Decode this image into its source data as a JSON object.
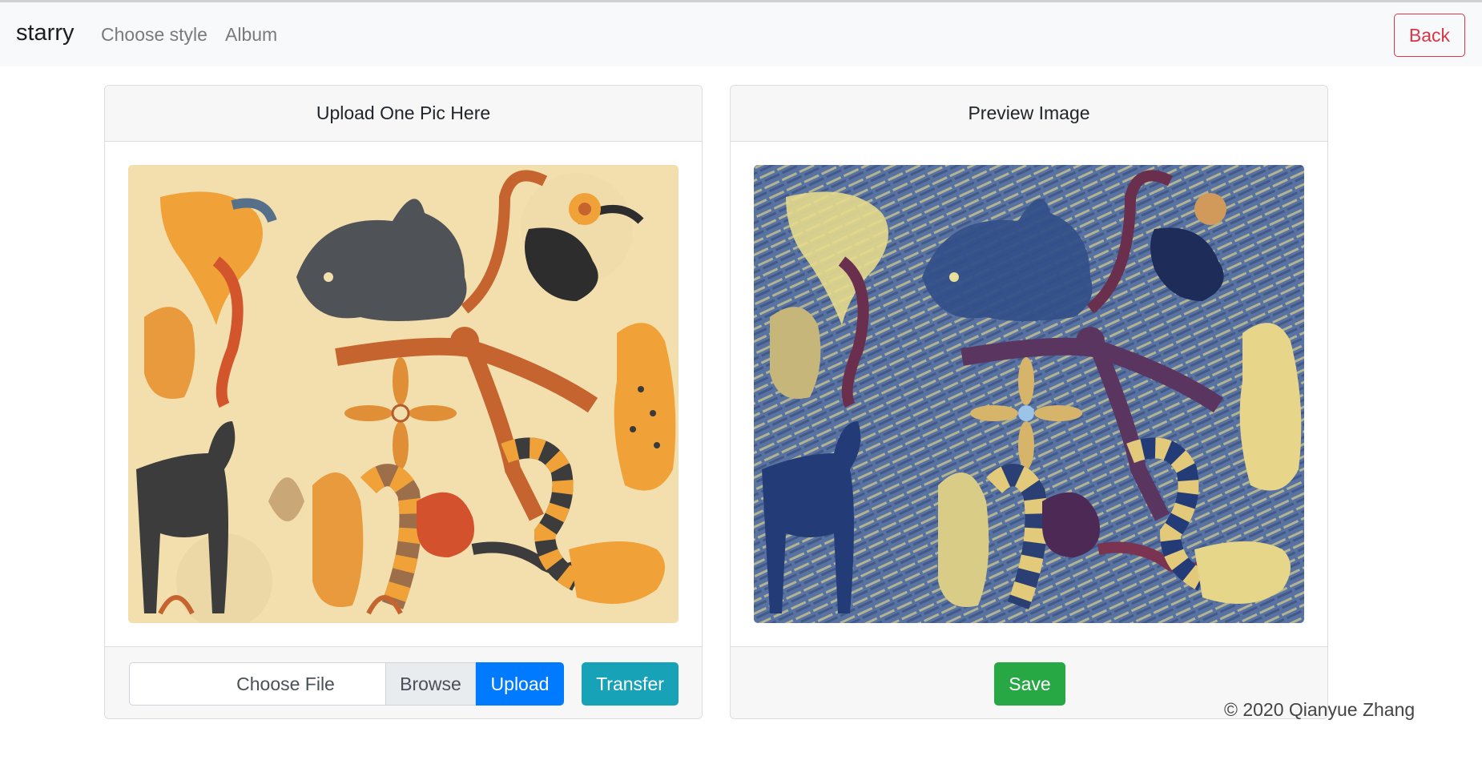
{
  "navbar": {
    "brand": "starry",
    "links": [
      {
        "label": "Choose style"
      },
      {
        "label": "Album"
      }
    ],
    "back_label": "Back"
  },
  "upload_card": {
    "title": "Upload One Pic Here",
    "file_placeholder": "Choose File",
    "browse_label": "Browse",
    "upload_label": "Upload",
    "transfer_label": "Transfer"
  },
  "preview_card": {
    "title": "Preview Image",
    "save_label": "Save"
  },
  "footer": {
    "copyright": "© 2020 Qianyue Zhang"
  },
  "colors": {
    "primary": "#007bff",
    "info": "#17a2b8",
    "success": "#28a745",
    "danger": "#dc3545",
    "original_bg": "#f3dfae",
    "styled_bg": "#4e6a9a"
  }
}
